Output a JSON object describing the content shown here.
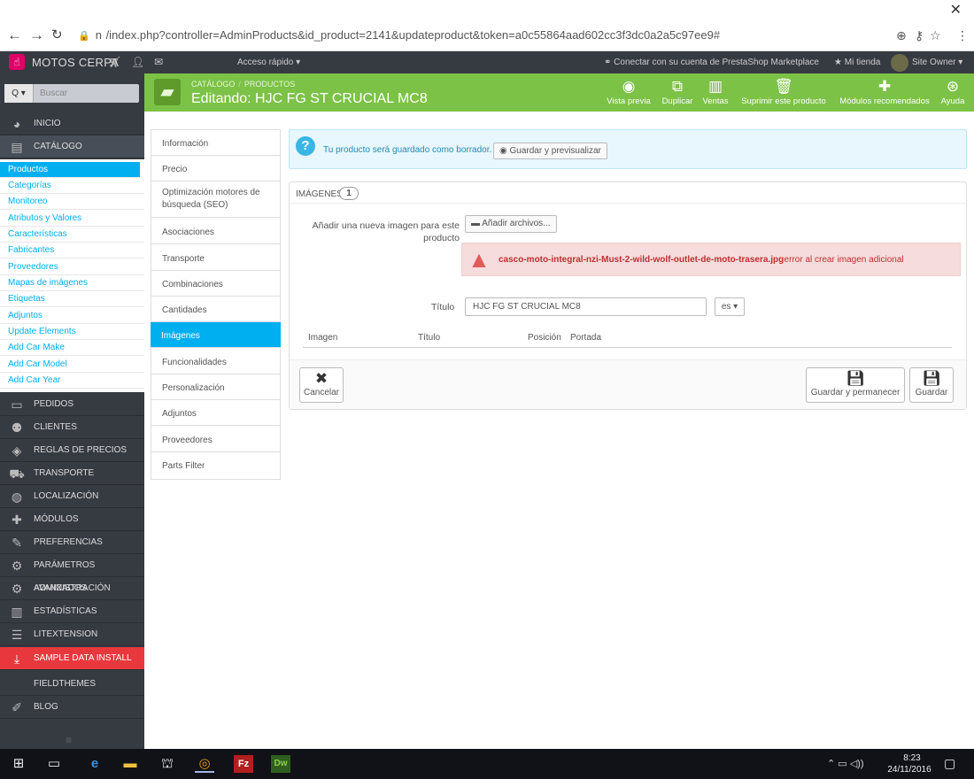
{
  "browser": {
    "url": "/index.php?controller=AdminProducts&id_product=2141&updateproduct&token=a0c55864aad602cc3f3dc0a2a5c97ee9#",
    "url_prefix": "n"
  },
  "header": {
    "shop_name": "MOTOS CERPA",
    "quick_access": "Acceso rápido ▾",
    "marketplace": "Conectar con su cuenta de PrestaShop Marketplace",
    "my_shop": "Mi tienda",
    "user": "Site Owner ▾"
  },
  "sidebar": {
    "search_btn": "Q ▾",
    "search_placeholder": "Buscar",
    "main_items": [
      {
        "label": "INICIO",
        "icon": "dashboard-icon"
      },
      {
        "label": "CATÁLOGO",
        "icon": "catalog-icon"
      },
      {
        "label": "PEDIDOS",
        "icon": "orders-icon"
      },
      {
        "label": "CLIENTES",
        "icon": "customers-icon"
      },
      {
        "label": "REGLAS DE PRECIOS",
        "icon": "price-rules-icon"
      },
      {
        "label": "TRANSPORTE",
        "icon": "truck-icon"
      },
      {
        "label": "LOCALIZACIÓN",
        "icon": "globe-icon"
      },
      {
        "label": "MÓDULOS",
        "icon": "puzzle-icon"
      },
      {
        "label": "PREFERENCIAS",
        "icon": "wrench-icon"
      },
      {
        "label": "PARÁMETROS AVANZADOS",
        "icon": "cogs-icon"
      },
      {
        "label": "ADMINISTRACIÓN",
        "icon": "gear-icon"
      },
      {
        "label": "ESTADÍSTICAS",
        "icon": "stats-icon"
      },
      {
        "label": "LITEXTENSION",
        "icon": "list-icon"
      },
      {
        "label": "SAMPLE DATA INSTALL",
        "icon": "download-icon"
      },
      {
        "label": "FIELDTHEMES",
        "icon": ""
      },
      {
        "label": "BLOG",
        "icon": "pencil-icon"
      }
    ],
    "sub_items": [
      "Productos",
      "Categorías",
      "Monitoreo",
      "Atributos y Valores",
      "Características",
      "Fabricantes",
      "Proveedores",
      "Mapas de imágenes",
      "Etiquetas",
      "Adjuntos",
      "Update Elements",
      "Add Car Make",
      "Add Car Model",
      "Add Car Year"
    ]
  },
  "page": {
    "breadcrumb": [
      "CATÁLOGO",
      "PRODUCTOS"
    ],
    "title": "Editando: HJC FG ST CRUCIAL MC8",
    "toolbar": [
      "Vista previa",
      "Duplicar",
      "Ventas",
      "Suprimir este producto",
      "Módulos recomendados",
      "Ayuda"
    ]
  },
  "tabs": [
    "Información",
    "Precio",
    "Optimización motores de búsqueda (SEO)",
    "Asociaciones",
    "Transporte",
    "Combinaciones",
    "Cantidades",
    "Imágenes",
    "Funcionalidades",
    "Personalización",
    "Adjuntos",
    "Proveedores",
    "Parts Filter"
  ],
  "info": {
    "text": "Tu producto será guardado como borrador.",
    "button": "Guardar y previsualizar"
  },
  "images_panel": {
    "title": "IMÁGENES",
    "count": "1",
    "add_label": "Añadir una nueva imagen para este producto",
    "add_button": "Añadir archivos...",
    "error_file": "casco-moto-integral-nzi-Must-2-wild-wolf-outlet-de-moto-trasera.jpg",
    "error_msg": ": error al crear imagen adicional",
    "title_label": "Título",
    "title_value": "HJC FG ST CRUCIAL MC8",
    "lang": "es ▾",
    "columns": [
      "Imagen",
      "Título",
      "Posición",
      "Portada"
    ],
    "cancel": "Cancelar",
    "save_stay": "Guardar y permanecer",
    "save": "Guardar"
  },
  "taskbar": {
    "time": "8:23",
    "date": "24/11/2016"
  },
  "colors": {
    "header_green": "#7cc246",
    "accent_blue": "#00aff0",
    "sidebar_dark": "#363a41",
    "error_red": "#bf3030"
  }
}
